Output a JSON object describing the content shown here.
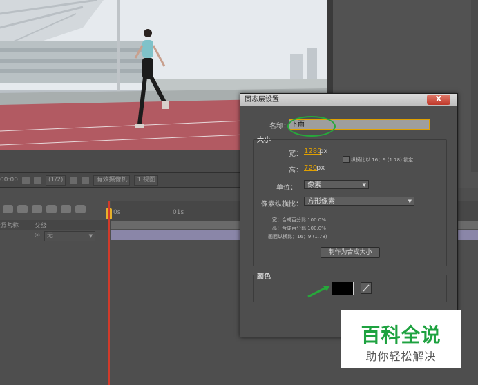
{
  "comp_toolbar": {
    "timecode": "00:00",
    "resolution": "(1/2)",
    "camera": "有效摄像机",
    "views": "1 视图"
  },
  "timeline": {
    "time_ticks": [
      "0s",
      "01s"
    ],
    "col_source": "源名称",
    "col_parent": "父级",
    "parent_value": "无"
  },
  "dialog": {
    "title": "固态层设置",
    "close_label": "X",
    "name_label": "名称：",
    "name_value": "下雨",
    "size_section": "大小",
    "width_label": "宽：",
    "width_value": "1280",
    "width_unit": "px",
    "height_label": "高：",
    "height_value": "720",
    "height_unit": "px",
    "lock_label": "纵横比以 16：9 (1.78) 锁定",
    "units_label": "单位：",
    "units_value": "像素",
    "par_label": "像素纵横比：",
    "par_value": "方形像素",
    "info_width": "宽：合成百分比 100.0%",
    "info_height": "高：合成百分比 100.0%",
    "info_frame": "画面纵横比：16：9 (1.78)",
    "make_comp_size": "制作为合成大小",
    "color_section": "颜色",
    "color_value": "#000000"
  },
  "watermark": {
    "main": "百科全说",
    "sub": "助你轻松解决"
  },
  "colors": {
    "accent_link": "#e0a000",
    "annotation_green": "#27a83b",
    "playhead": "#d23a2a"
  }
}
